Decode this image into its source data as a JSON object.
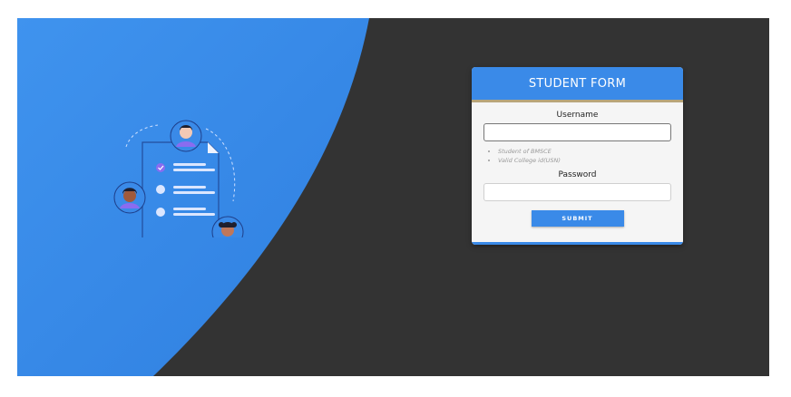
{
  "form": {
    "title": "STUDENT FORM",
    "username_label": "Username",
    "username_value": "",
    "hints": [
      "Student of BMSCE",
      "Valid College id(USN)"
    ],
    "password_label": "Password",
    "password_value": "",
    "submit_label": "SUBMIT"
  },
  "colors": {
    "accent": "#3a8ae8",
    "background_dark": "#333333",
    "header_rule": "#b8a57a",
    "illustration_purple": "#8a6cf0"
  },
  "icons": {
    "illustration": "checklist-with-people-icon"
  }
}
